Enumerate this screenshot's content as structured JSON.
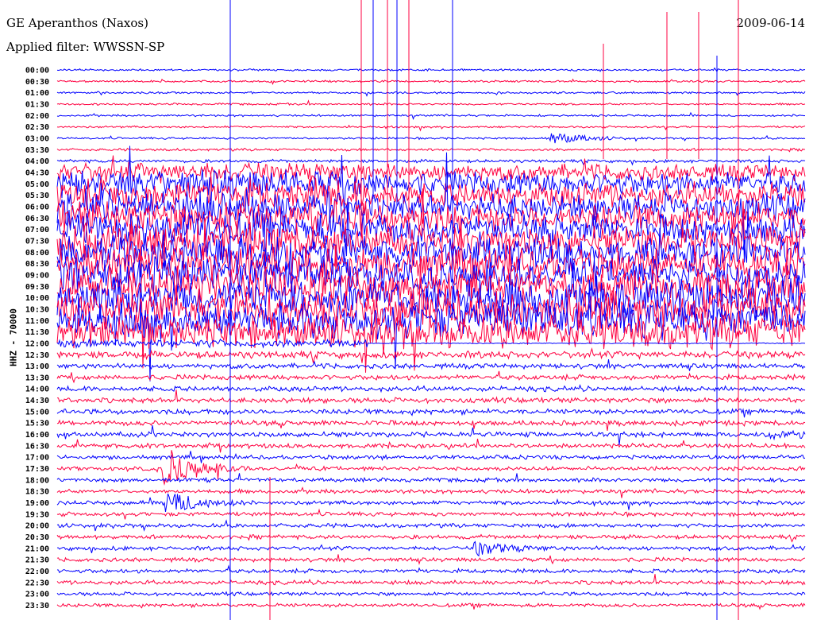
{
  "header": {
    "title": "GE Aperanthos (Naxos)",
    "filter": "Applied filter: WWSSN-SP",
    "date": "2009-06-14",
    "channel": "HHZ - 70000"
  },
  "chart_data": {
    "type": "line",
    "title": "GE Aperanthos (Naxos)",
    "subtitle": "Applied filter: WWSSN-SP",
    "ylabel": "HHZ - 70000",
    "minutes_per_line": 30,
    "colors": [
      "#0000ff",
      "#ff0040"
    ],
    "rows": [
      "00:00",
      "00:30",
      "01:00",
      "01:30",
      "02:00",
      "02:30",
      "03:00",
      "03:30",
      "04:00",
      "04:30",
      "05:00",
      "05:30",
      "06:00",
      "06:30",
      "07:00",
      "07:30",
      "08:00",
      "08:30",
      "09:00",
      "09:30",
      "10:00",
      "10:30",
      "11:00",
      "11:30",
      "12:00",
      "12:30",
      "13:00",
      "13:30",
      "14:00",
      "14:30",
      "15:00",
      "15:30",
      "16:00",
      "16:30",
      "17:00",
      "17:30",
      "18:00",
      "18:30",
      "19:00",
      "19:30",
      "20:00",
      "20:30",
      "21:00",
      "21:30",
      "22:00",
      "22:30",
      "23:00",
      "23:30"
    ],
    "noise_level": [
      2,
      2,
      2,
      2,
      2,
      2,
      2,
      2.5,
      3,
      20,
      28,
      30,
      32,
      34,
      36,
      36,
      38,
      38,
      38,
      38,
      38,
      36,
      34,
      30,
      8,
      7,
      5,
      5,
      5,
      5,
      5,
      5,
      5,
      4.5,
      4,
      4,
      4,
      4,
      4,
      4,
      4,
      4,
      4,
      4,
      4,
      4,
      3.5,
      3.5
    ],
    "events": [
      {
        "row": 6,
        "minute": 20,
        "amp": 12
      },
      {
        "row": 35,
        "minute": 4.5,
        "amp": 40
      },
      {
        "row": 38,
        "minute": 4.5,
        "amp": 25
      },
      {
        "row": 42,
        "minute": 17,
        "amp": 14
      },
      {
        "row": 32,
        "minute": 29,
        "amp": 10
      }
    ]
  }
}
